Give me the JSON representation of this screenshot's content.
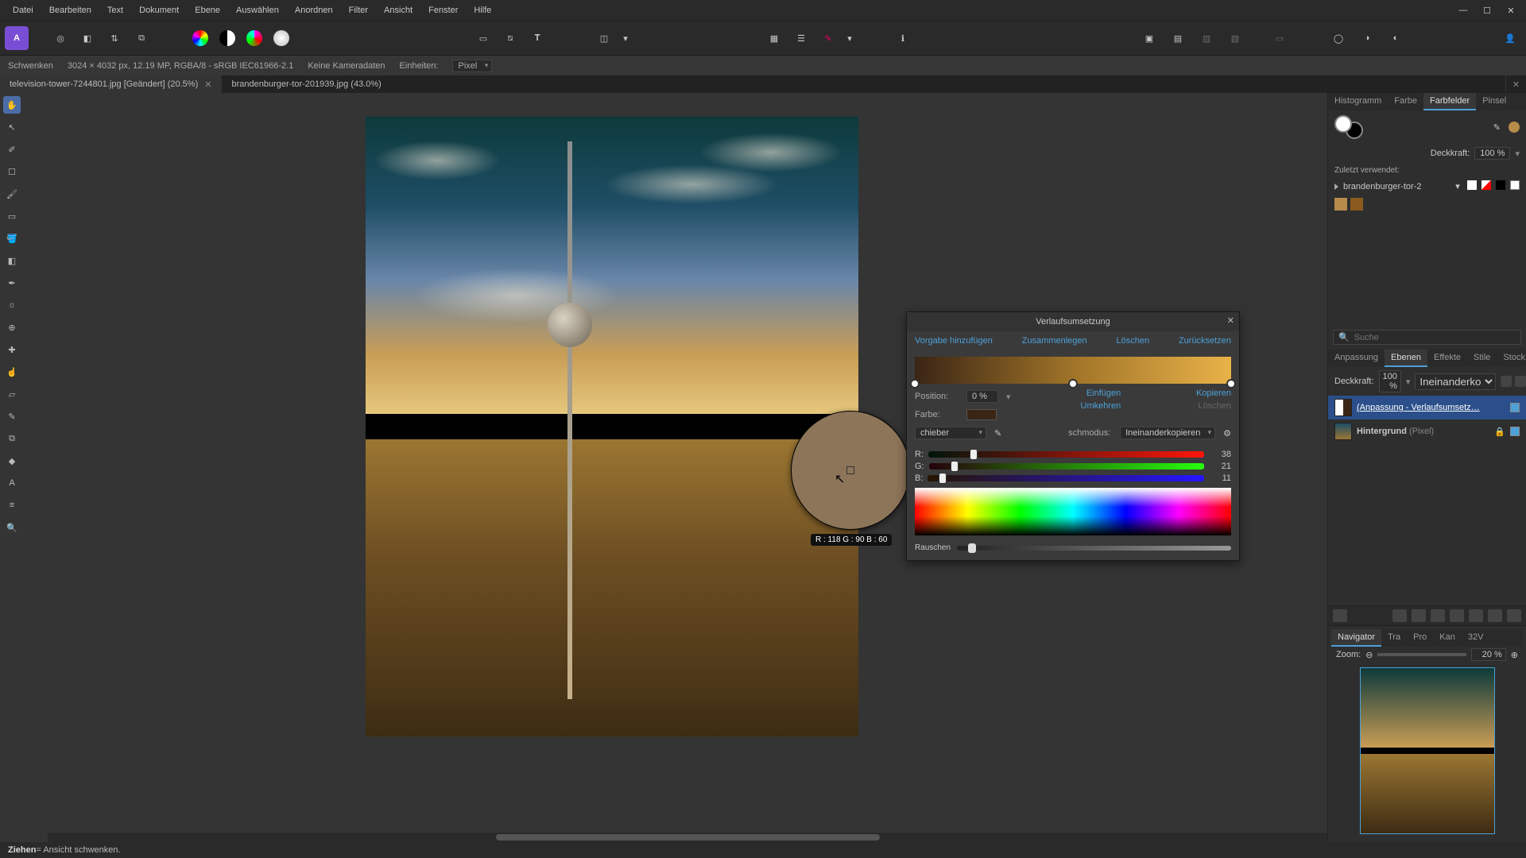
{
  "menu": {
    "items": [
      "Datei",
      "Bearbeiten",
      "Text",
      "Dokument",
      "Ebene",
      "Auswählen",
      "Anordnen",
      "Filter",
      "Ansicht",
      "Fenster",
      "Hilfe"
    ]
  },
  "contextbar": {
    "tool": "Schwenken",
    "dims": "3024 × 4032 px, 12.19 MP, RGBA/8 - sRGB IEC61966-2.1",
    "camera": "Keine Kameradaten",
    "units_label": "Einheiten:",
    "units_value": "Pixel"
  },
  "tabs": [
    {
      "label": "television-tower-7244801.jpg [Geändert] (20.5%)",
      "active": true
    },
    {
      "label": "brandenburger-tor-201939.jpg (43.0%)",
      "active": false
    }
  ],
  "lens": {
    "value": "R : 118 G : 90 B : 60"
  },
  "dlg": {
    "title": "Verlaufsumsetzung",
    "add_preset": "Vorgabe hinzufügen",
    "merge": "Zusammenlegen",
    "del": "Löschen",
    "reset": "Zurücksetzen",
    "pos_label": "Position:",
    "pos_val": "0 %",
    "color_label": "Farbe:",
    "insert": "Einfügen",
    "copy": "Kopieren",
    "invert": "Umkehren",
    "del2": "Löschen",
    "selector_label": "chieber",
    "blend_label": "schmodus:",
    "blend_value": "Ineinanderkopieren",
    "rgb": {
      "r": 38,
      "g": 21,
      "b": 11
    },
    "label_r": "R:",
    "label_g": "G:",
    "label_b": "B:",
    "noise_label": "Rauschen"
  },
  "right": {
    "top_tabs": [
      "Histogramm",
      "Farbe",
      "Farbfelder",
      "Pinsel"
    ],
    "top_active": "Farbfelder",
    "opacity_label": "Deckkraft:",
    "opacity_value": "100 %",
    "recent_label": "Zuletzt verwendet:",
    "asset_name": "brandenburger-tor-2",
    "search_placeholder": "Suche",
    "mid_tabs": [
      "Anpassung",
      "Ebenen",
      "Effekte",
      "Stile",
      "Stock"
    ],
    "mid_active": "Ebenen",
    "mix_opacity_label": "Deckkraft:",
    "mix_opacity_value": "100 %",
    "blend_value": "Ineinanderko",
    "layers": [
      {
        "name": "(Anpassung - Verlaufsumsetz…",
        "sel": true,
        "type": ""
      },
      {
        "name": "Hintergrund",
        "sel": false,
        "type": "(Pixel)"
      }
    ],
    "nav_tabs": [
      "Navigator",
      "Tra",
      "Pro",
      "Kan",
      "32V"
    ],
    "nav_active": "Navigator",
    "zoom_label": "Zoom:",
    "zoom_value": "20 %"
  },
  "status": {
    "key": "Ziehen",
    "text": " = Ansicht schwenken."
  }
}
